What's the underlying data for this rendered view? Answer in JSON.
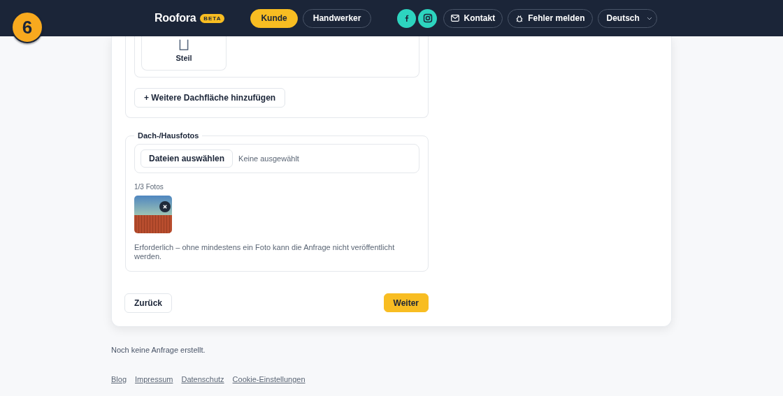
{
  "step_badge": "6",
  "header": {
    "brand": "Roofora",
    "badge": "BETA",
    "roles": [
      {
        "label": "Kunde",
        "selected": true
      },
      {
        "label": "Handwerker",
        "selected": false
      }
    ],
    "contact_button": "Kontakt",
    "bug_report_button": "Fehler melden",
    "language_select": "Deutsch"
  },
  "roof_areas": {
    "tiles": [
      {
        "label": "Steil",
        "selected": false
      }
    ],
    "add_button": "+ Weitere Dachfläche hinzufügen"
  },
  "photos": {
    "legend": "Dach-/Hausfotos",
    "file_button": "Dateien auswählen",
    "file_status": "Keine ausgewählt",
    "count": "1/3 Fotos",
    "note": "Erforderlich – ohne mindestens ein Foto kann die Anfrage nicht veröffentlicht werden."
  },
  "nav": {
    "back": "Zurück",
    "next": "Weiter"
  },
  "status": "Noch keine Anfrage erstellt.",
  "footer_links": [
    "Blog",
    "Impressum",
    "Datenschutz",
    "Cookie-Einstellungen"
  ]
}
